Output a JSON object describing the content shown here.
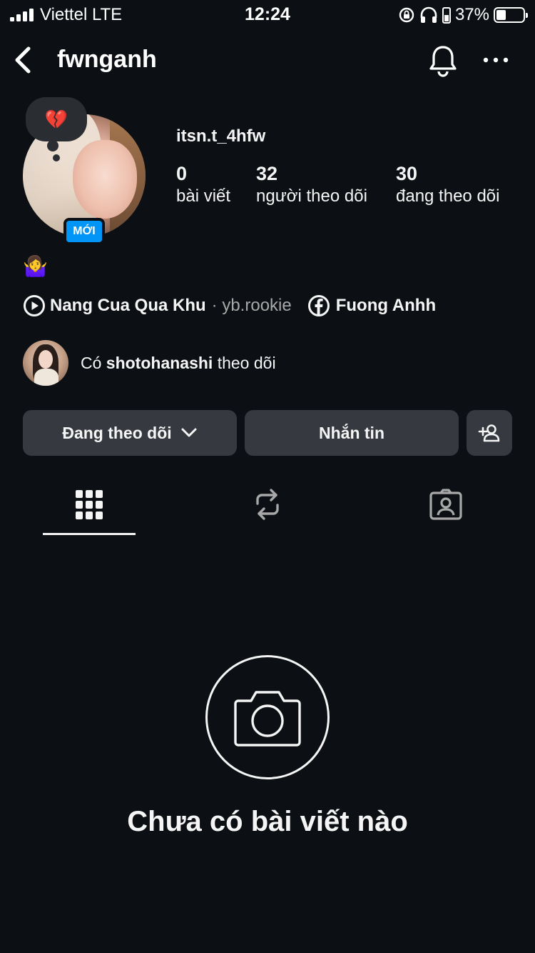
{
  "status_bar": {
    "carrier": "Viettel  LTE",
    "time": "12:24",
    "battery_percent": "37%",
    "battery_level": 0.37
  },
  "header": {
    "username": "fwnganh",
    "icons": [
      "back-icon",
      "bell-icon",
      "more-icon"
    ]
  },
  "profile": {
    "note_emoji": "💔",
    "new_badge": "MỚI",
    "handle": "itsn.t_4hfw",
    "stats": [
      {
        "value": "0",
        "label": "bài viết"
      },
      {
        "value": "32",
        "label": "người theo dõi"
      },
      {
        "value": "30",
        "label": "đang theo dõi"
      }
    ],
    "bio_emoji": "🤷‍♀️",
    "music": {
      "title": "Nang Cua Qua Khu",
      "artist": "· yb.rookie"
    },
    "facebook_name": "Fuong Anhh",
    "followed_by": {
      "prefix": "Có ",
      "user": "shotohanashi",
      "suffix": " theo dõi"
    }
  },
  "actions": {
    "following_label": "Đang theo dõi",
    "message_label": "Nhắn tin"
  },
  "tabs": [
    "grid-icon",
    "repost-icon",
    "tagged-icon"
  ],
  "empty_state": {
    "title": "Chưa có bài viết nào"
  },
  "colors": {
    "background": "#0c1014",
    "button": "#363a40",
    "badge": "#0095f6"
  }
}
